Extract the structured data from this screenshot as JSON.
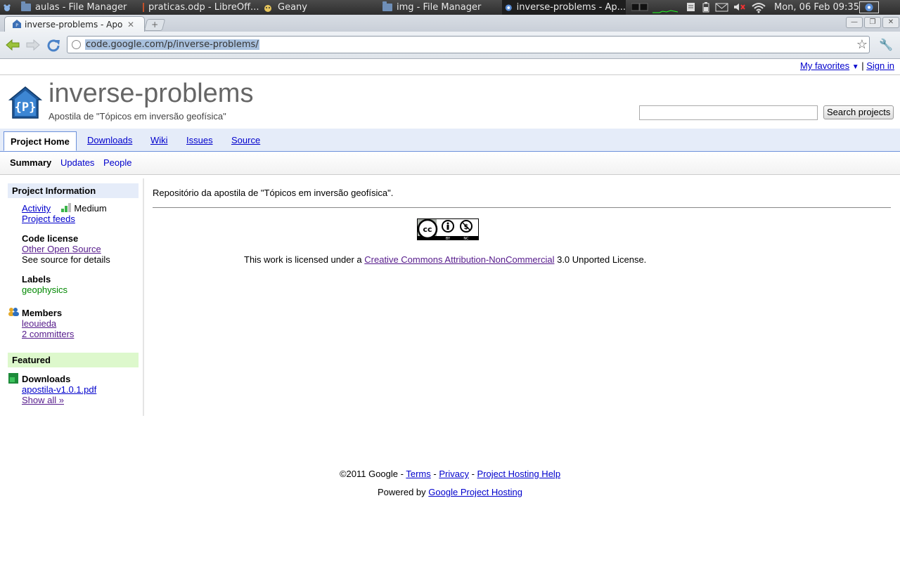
{
  "taskbar": {
    "items": [
      {
        "label": "aulas - File Manager"
      },
      {
        "label": "praticas.odp - LibreOff..."
      },
      {
        "label": "Geany"
      },
      {
        "label": "img - File Manager"
      },
      {
        "label": "inverse-problems - Ap..."
      }
    ],
    "clock": "Mon, 06 Feb  09:35"
  },
  "browser": {
    "tab_title": "inverse-problems - Apostila",
    "url": "code.google.com/p/inverse-problems/"
  },
  "userbar": {
    "favorites": "My favorites",
    "separator": "|",
    "sign_in": "Sign in"
  },
  "header": {
    "project_name": "inverse-problems",
    "summary": "Apostila de \"Tópicos em inversão geofísica\"",
    "search_button": "Search projects",
    "search_value": ""
  },
  "main_tabs": [
    {
      "label": "Project Home"
    },
    {
      "label": "Downloads"
    },
    {
      "label": "Wiki"
    },
    {
      "label": "Issues"
    },
    {
      "label": "Source"
    }
  ],
  "sub_tabs": [
    {
      "label": "Summary"
    },
    {
      "label": "Updates"
    },
    {
      "label": "People"
    }
  ],
  "sidebar": {
    "project_info_title": "Project Information",
    "activity_link": "Activity",
    "activity_level": "Medium",
    "activity_bars_lit": 2,
    "feeds_link": "Project feeds",
    "code_license_title": "Code license",
    "code_license_link": "Other Open Source",
    "code_license_note": "See source for details",
    "labels_title": "Labels",
    "labels": [
      "geophysics"
    ],
    "members_title": "Members",
    "member_link": "leouieda",
    "committers_link": "2 committers",
    "featured_title": "Featured",
    "downloads_title": "Downloads",
    "download_file": "apostila-v1.0.1.pdf",
    "show_all": "Show all »"
  },
  "content": {
    "description": "Repositório da apostila de \"Tópicos em inversão geofísica\".",
    "license_prefix": "This work is licensed under a",
    "license_link": "Creative Commons Attribution-NonCommercial",
    "license_suffix": "3.0 Unported License.",
    "badge_by": "BY",
    "badge_nc": "NC"
  },
  "footer": {
    "copyright": "©2011 Google -",
    "terms": "Terms",
    "privacy": "Privacy",
    "help": "Project Hosting Help",
    "dash": "-",
    "powered_by": "Powered by",
    "hosting_link": "Google Project Hosting"
  },
  "colors": {
    "link": "#0000cc",
    "visited": "#551a8b",
    "tab_bg": "#e5ecf9",
    "tab_border": "#6b90da",
    "featured_bg": "#ddf8cc",
    "label_green": "#008800"
  }
}
